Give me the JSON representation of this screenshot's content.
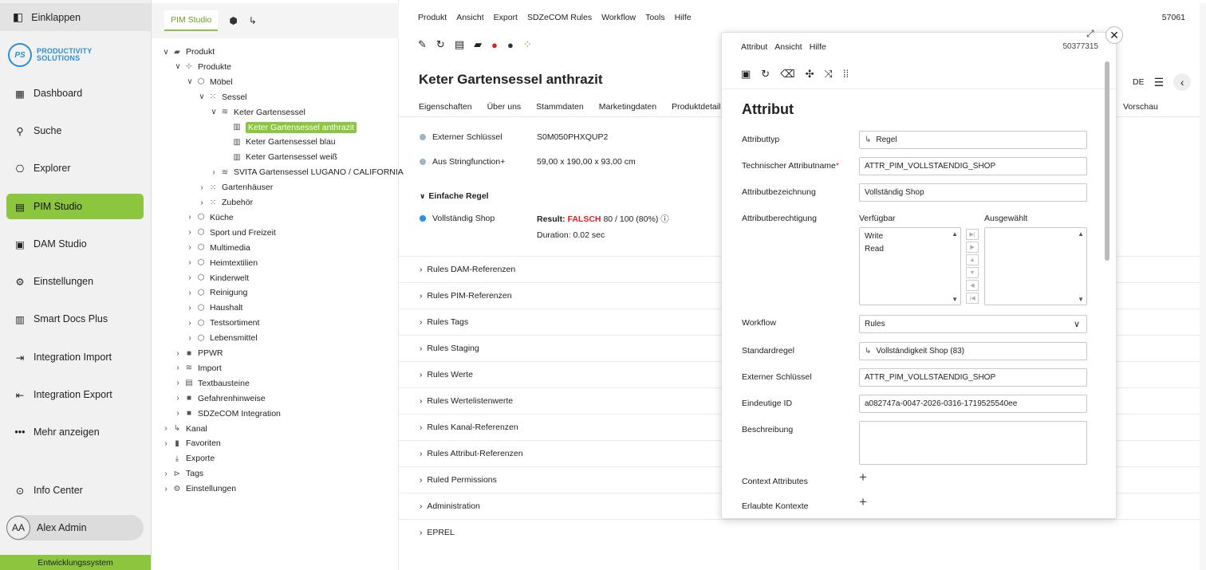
{
  "nav": {
    "collapse": "Einklappen",
    "logo_mark": "PS",
    "logo_line1": "PRODUCTIVITY",
    "logo_line2": "SOLUTIONS",
    "items": [
      {
        "label": "Dashboard",
        "icon": "dashboard-icon"
      },
      {
        "label": "Suche",
        "icon": "search-icon"
      },
      {
        "label": "Explorer",
        "icon": "explorer-icon"
      },
      {
        "label": "PIM Studio",
        "icon": "pim-icon"
      },
      {
        "label": "DAM Studio",
        "icon": "image-icon"
      },
      {
        "label": "Einstellungen",
        "icon": "gear-icon"
      },
      {
        "label": "Smart Docs Plus",
        "icon": "document-icon"
      },
      {
        "label": "Integration Import",
        "icon": "import-icon"
      },
      {
        "label": "Integration Export",
        "icon": "export-icon"
      },
      {
        "label": "Mehr anzeigen",
        "icon": "more-icon"
      },
      {
        "label": "Info Center",
        "icon": "location-icon"
      }
    ],
    "user_initials": "AA",
    "user_name": "Alex Admin",
    "environment": "Entwicklungssystem"
  },
  "tree": {
    "tab": "PIM Studio",
    "rows": [
      {
        "label": "Produkt"
      },
      {
        "label": "Produkte"
      },
      {
        "label": "Möbel"
      },
      {
        "label": "Sessel"
      },
      {
        "label": "Keter Gartensessel"
      },
      {
        "label": "Keter Gartensessel anthrazit"
      },
      {
        "label": "Keter Gartensessel blau"
      },
      {
        "label": "Keter Gartensessel weiß"
      },
      {
        "label": "SVITA Gartensessel LUGANO / CALIFORNIA"
      },
      {
        "label": "Gartenhäuser"
      },
      {
        "label": "Zubehör"
      },
      {
        "label": "Küche"
      },
      {
        "label": "Sport und Freizeit"
      },
      {
        "label": "Multimedia"
      },
      {
        "label": "Heimtextilien"
      },
      {
        "label": "Kinderwelt"
      },
      {
        "label": "Reinigung"
      },
      {
        "label": "Haushalt"
      },
      {
        "label": "Testsortiment"
      },
      {
        "label": "Lebensmittel"
      },
      {
        "label": "PPWR"
      },
      {
        "label": "Import"
      },
      {
        "label": "Textbausteine"
      },
      {
        "label": "Gefahrenhinweise"
      },
      {
        "label": "SDZeCOM Integration"
      },
      {
        "label": "Kanal"
      },
      {
        "label": "Favoriten"
      },
      {
        "label": "Exporte"
      },
      {
        "label": "Tags"
      },
      {
        "label": "Einstellungen"
      }
    ]
  },
  "main": {
    "menu": [
      "Produkt",
      "Ansicht",
      "Export",
      "SDZeCOM Rules",
      "Workflow",
      "Tools",
      "Hilfe"
    ],
    "record_number": "57061",
    "title": "Keter Gartensessel anthrazit",
    "tabs": [
      "Eigenschaften",
      "Über uns",
      "Stammdaten",
      "Marketingdaten",
      "Produktdetails"
    ],
    "tab_right": "Vorschau",
    "language": "DE",
    "attributes": [
      {
        "label": "Externer Schlüssel",
        "value": "S0M050PHXQUP2",
        "dot_color": "#9bb6c9"
      },
      {
        "label": "Aus Stringfunction+",
        "value": "59,00 x 190,00 x 93,00 cm",
        "dot_color": "#9bb6c9"
      }
    ],
    "section": "Einfache Regel",
    "rule": {
      "label": "Vollständig Shop",
      "dot_color": "#1e90ff",
      "result_prefix": "Result:",
      "result_status": "FALSCH",
      "result_score": "80 / 100 (80%)",
      "duration": "Duration: 0.02 sec"
    },
    "accordions": [
      "Rules DAM-Referenzen",
      "Rules PIM-Referenzen",
      "Rules Tags",
      "Rules Staging",
      "Rules Werte",
      "Rules Wertelistenwerte",
      "Rules Kanal-Referenzen",
      "Rules Attribut-Referenzen",
      "Ruled Permissions",
      "Administration",
      "EPREL"
    ]
  },
  "dialog": {
    "menu": [
      "Attribut",
      "Ansicht",
      "Hilfe"
    ],
    "record_number": "50377315",
    "title": "Attribut",
    "fields": {
      "attributtyp_label": "Attributtyp",
      "attributtyp_value": "Regel",
      "technischer_label": "Technischer Attributname",
      "technischer_value": "ATTR_PIM_VOLLSTAENDIG_SHOP",
      "bezeichnung_label": "Attributbezeichnung",
      "bezeichnung_value": "Vollständig Shop",
      "berechtigung_label": "Attributberechtigung",
      "verfuegbar_label": "Verfügbar",
      "ausgewaehlt_label": "Ausgewählt",
      "verfuegbar_options": [
        "Write",
        "Read"
      ],
      "workflow_label": "Workflow",
      "workflow_value": "Rules",
      "standardregel_label": "Standardregel",
      "standardregel_value": "Vollständigkeit Shop (83)",
      "extkey_label": "Externer Schlüssel",
      "extkey_value": "ATTR_PIM_VOLLSTAENDIG_SHOP",
      "uid_label": "Eindeutige ID",
      "uid_value": "a082747a-0047-2026-0316-1719525540ee",
      "beschreibung_label": "Beschreibung",
      "beschreibung_value": "",
      "context_label": "Context Attributes",
      "kontexte_label": "Erlaubte Kontexte"
    }
  }
}
